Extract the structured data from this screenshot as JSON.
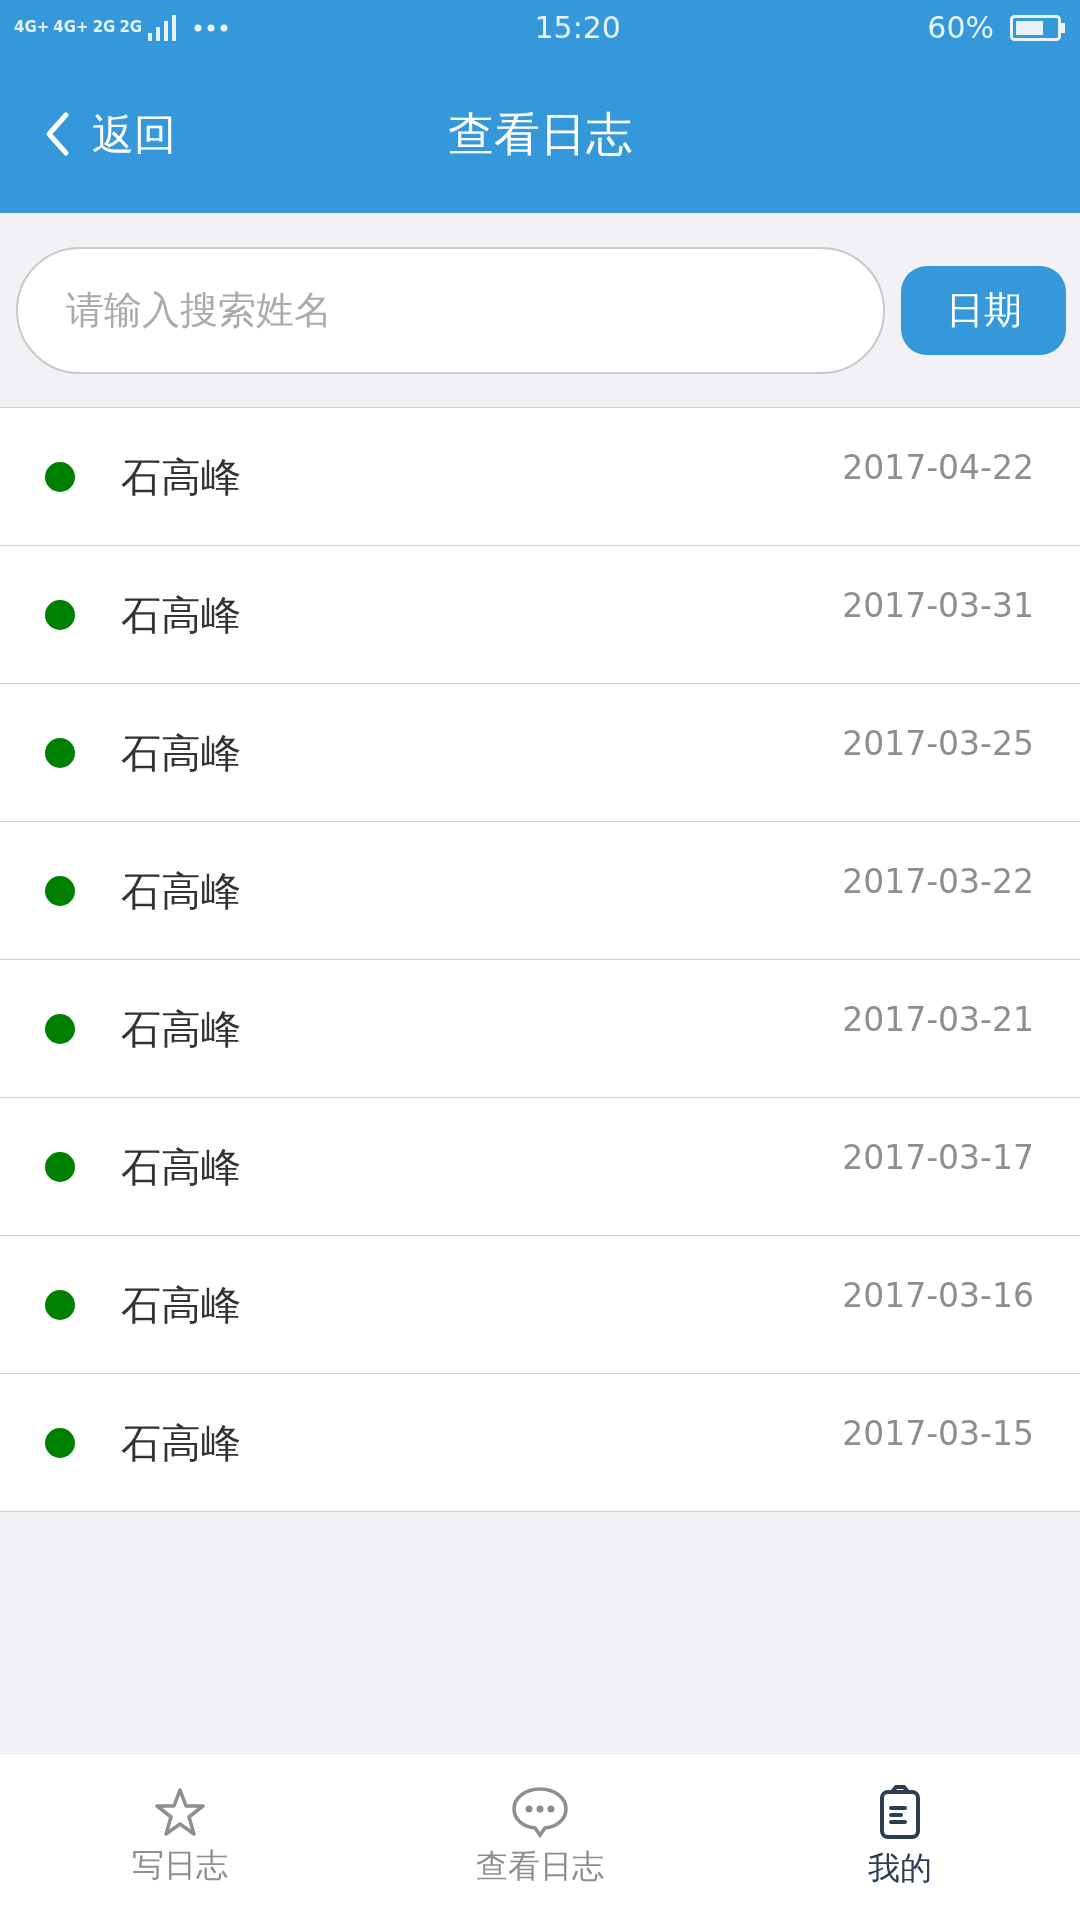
{
  "status_bar": {
    "network_labels": [
      "4G+",
      "4G+",
      "2G",
      "2G"
    ],
    "time": "15:20",
    "battery": "60%"
  },
  "header": {
    "back": "返回",
    "title": "查看日志"
  },
  "search": {
    "placeholder": "请输入搜索姓名",
    "button": "日期"
  },
  "logs": [
    {
      "name": "石高峰",
      "date": "2017-04-22",
      "color": "#008000"
    },
    {
      "name": "石高峰",
      "date": "2017-03-31",
      "color": "#008000"
    },
    {
      "name": "石高峰",
      "date": "2017-03-25",
      "color": "#008000"
    },
    {
      "name": "石高峰",
      "date": "2017-03-22",
      "color": "#008000"
    },
    {
      "name": "石高峰",
      "date": "2017-03-21",
      "color": "#008000"
    },
    {
      "name": "石高峰",
      "date": "2017-03-17",
      "color": "#008000"
    },
    {
      "name": "石高峰",
      "date": "2017-03-16",
      "color": "#008000"
    },
    {
      "name": "石高峰",
      "date": "2017-03-15",
      "color": "#008000"
    }
  ],
  "tabs": [
    {
      "label": "写日志",
      "kind": "star",
      "selected": false
    },
    {
      "label": "查看日志",
      "kind": "chat",
      "selected": false
    },
    {
      "label": "我的",
      "kind": "clipboard",
      "selected": true
    }
  ]
}
